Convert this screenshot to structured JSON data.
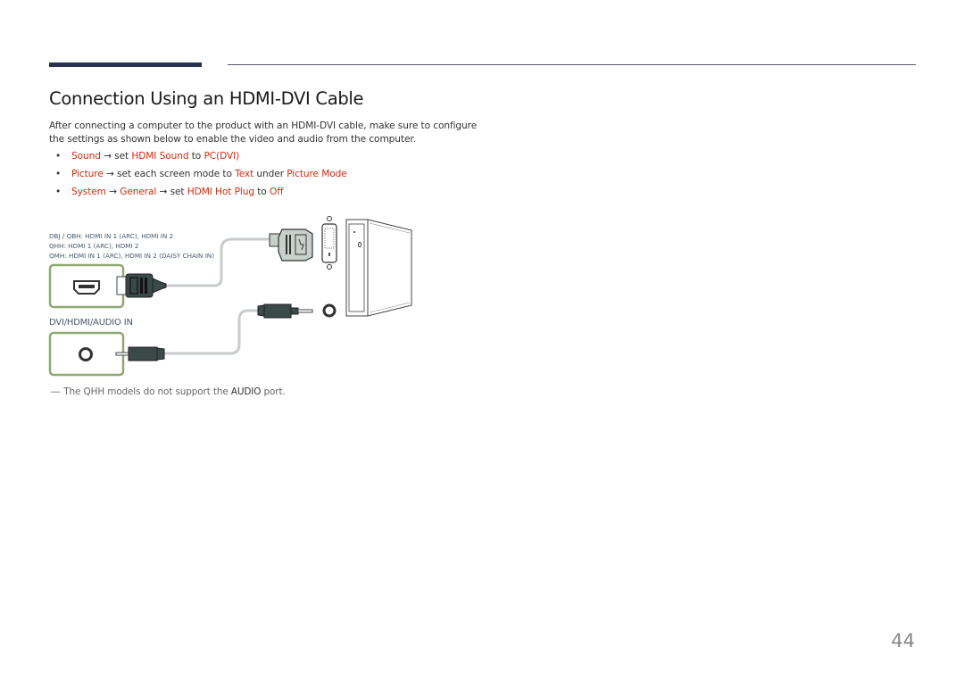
{
  "header": {
    "title": "Connection Using an HDMI-DVI Cable"
  },
  "intro": "After connecting a computer to the product with an HDMI-DVI cable, make sure to configure the settings as shown below to enable the video and audio from the computer.",
  "bullets": [
    {
      "parts": [
        {
          "t": "Sound",
          "hl": true
        },
        {
          "t": " → set ",
          "hl": false
        },
        {
          "t": "HDMI Sound",
          "hl": true
        },
        {
          "t": " to ",
          "hl": false
        },
        {
          "t": "PC(DVI)",
          "hl": true
        }
      ]
    },
    {
      "parts": [
        {
          "t": "Picture",
          "hl": true
        },
        {
          "t": " → set each screen mode to ",
          "hl": false
        },
        {
          "t": "Text",
          "hl": true
        },
        {
          "t": " under ",
          "hl": false
        },
        {
          "t": "Picture Mode",
          "hl": true
        }
      ]
    },
    {
      "parts": [
        {
          "t": "System",
          "hl": true
        },
        {
          "t": " → ",
          "hl": false
        },
        {
          "t": "General",
          "hl": true
        },
        {
          "t": " → set ",
          "hl": false
        },
        {
          "t": "HDMI Hot Plug",
          "hl": true
        },
        {
          "t": " to ",
          "hl": false
        },
        {
          "t": "Off",
          "hl": true
        }
      ]
    }
  ],
  "diagram": {
    "model_labels": [
      "DBJ / QBH: HDMI IN 1 (ARC), HDMI IN 2",
      "QHH: HDMI 1 (ARC), HDMI 2",
      "QMH: HDMI IN 1 (ARC), HDMI IN 2 (DAISY CHAIN IN)"
    ],
    "audio_port_label": "DVI/HDMI/AUDIO IN",
    "icons": [
      "hdmi-port-icon",
      "hdmi-plug-icon",
      "dvi-plug-icon",
      "dvi-port-icon",
      "audio-jack-icon",
      "audio-plug-icon",
      "pc-tower-icon"
    ]
  },
  "note": {
    "dash": "―",
    "before": "The QHH models do not support the ",
    "bold": "AUDIO",
    "after": " port."
  },
  "page_number": "44",
  "colors": {
    "highlight": "#d42a10",
    "accent_bar": "#2a3250",
    "port_border": "#8fa870",
    "connector": "#3a4a48"
  }
}
